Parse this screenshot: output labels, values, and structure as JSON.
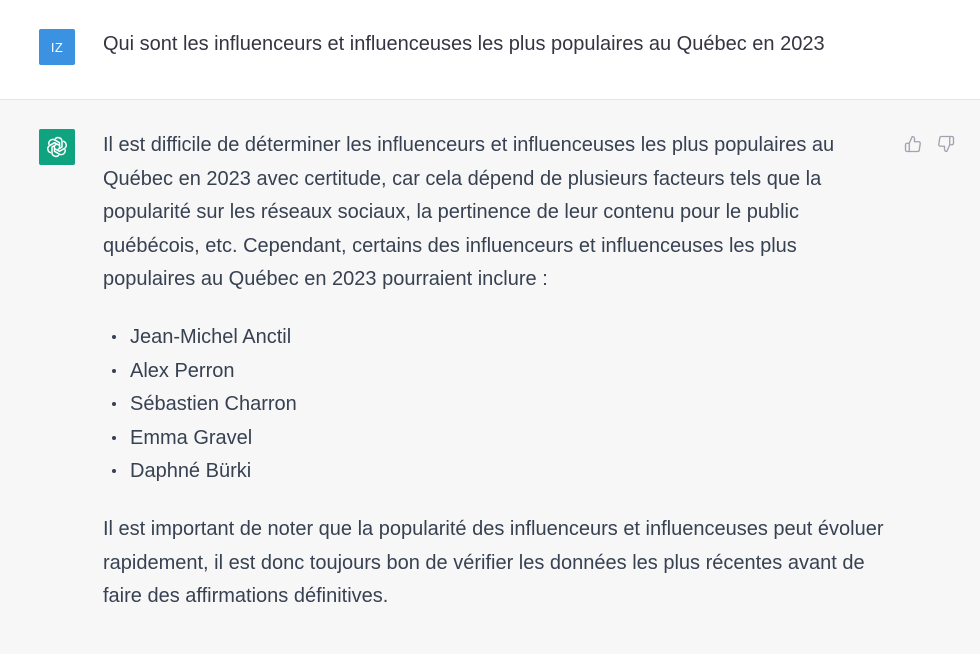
{
  "colors": {
    "user_avatar_bg": "#3b92e0",
    "assistant_avatar_bg": "#10a37f",
    "text": "#374151",
    "icon": "#a3a3b0"
  },
  "user": {
    "avatar_initials": "IZ",
    "message": "Qui sont les influenceurs et influenceuses les plus populaires au Québec en 2023"
  },
  "assistant": {
    "avatar_icon": "openai-logo-icon",
    "intro": "Il est difficile de déterminer les influenceurs et influenceuses les plus populaires au Québec en 2023 avec certitude, car cela dépend de plusieurs facteurs tels que la popularité sur les réseaux sociaux, la pertinence de leur contenu pour le public québécois, etc. Cependant, certains des influenceurs et influenceuses les plus populaires au Québec en 2023 pourraient inclure :",
    "list": [
      "Jean-Michel Anctil",
      "Alex Perron",
      "Sébastien Charron",
      "Emma Gravel",
      "Daphné Bürki"
    ],
    "outro": "Il est important de noter que la popularité des influenceurs et influenceuses peut évoluer rapidement, il est donc toujours bon de vérifier les données les plus récentes avant de faire des affirmations définitives.",
    "feedback": {
      "thumbs_up_icon": "thumbs-up-icon",
      "thumbs_down_icon": "thumbs-down-icon"
    }
  }
}
